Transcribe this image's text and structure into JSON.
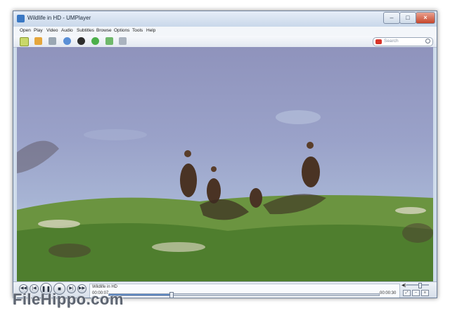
{
  "window": {
    "title": "Wildlife in HD - UMPlayer"
  },
  "menu": [
    "Open",
    "Play",
    "Video",
    "Audio",
    "Subtitles",
    "Browse",
    "Options",
    "Tools",
    "Help"
  ],
  "toolbar": {
    "icons": [
      "um-logo-icon",
      "folder-icon",
      "tv-icon",
      "globe-icon",
      "disc-icon",
      "chat-icon",
      "recycle-icon",
      "gear-icon"
    ],
    "search_placeholder": "Search"
  },
  "player": {
    "media_title": "Wildlife in HD",
    "time_elapsed": "00:00:07",
    "time_total": "00:00:30",
    "progress": 0.23,
    "volume": 0.6
  },
  "watermark": "FileHippo.com",
  "colors": {
    "accent": "#3a78c4",
    "close": "#c7462b",
    "sky": "#9aa2c9",
    "grass": "#5f8b3a"
  }
}
